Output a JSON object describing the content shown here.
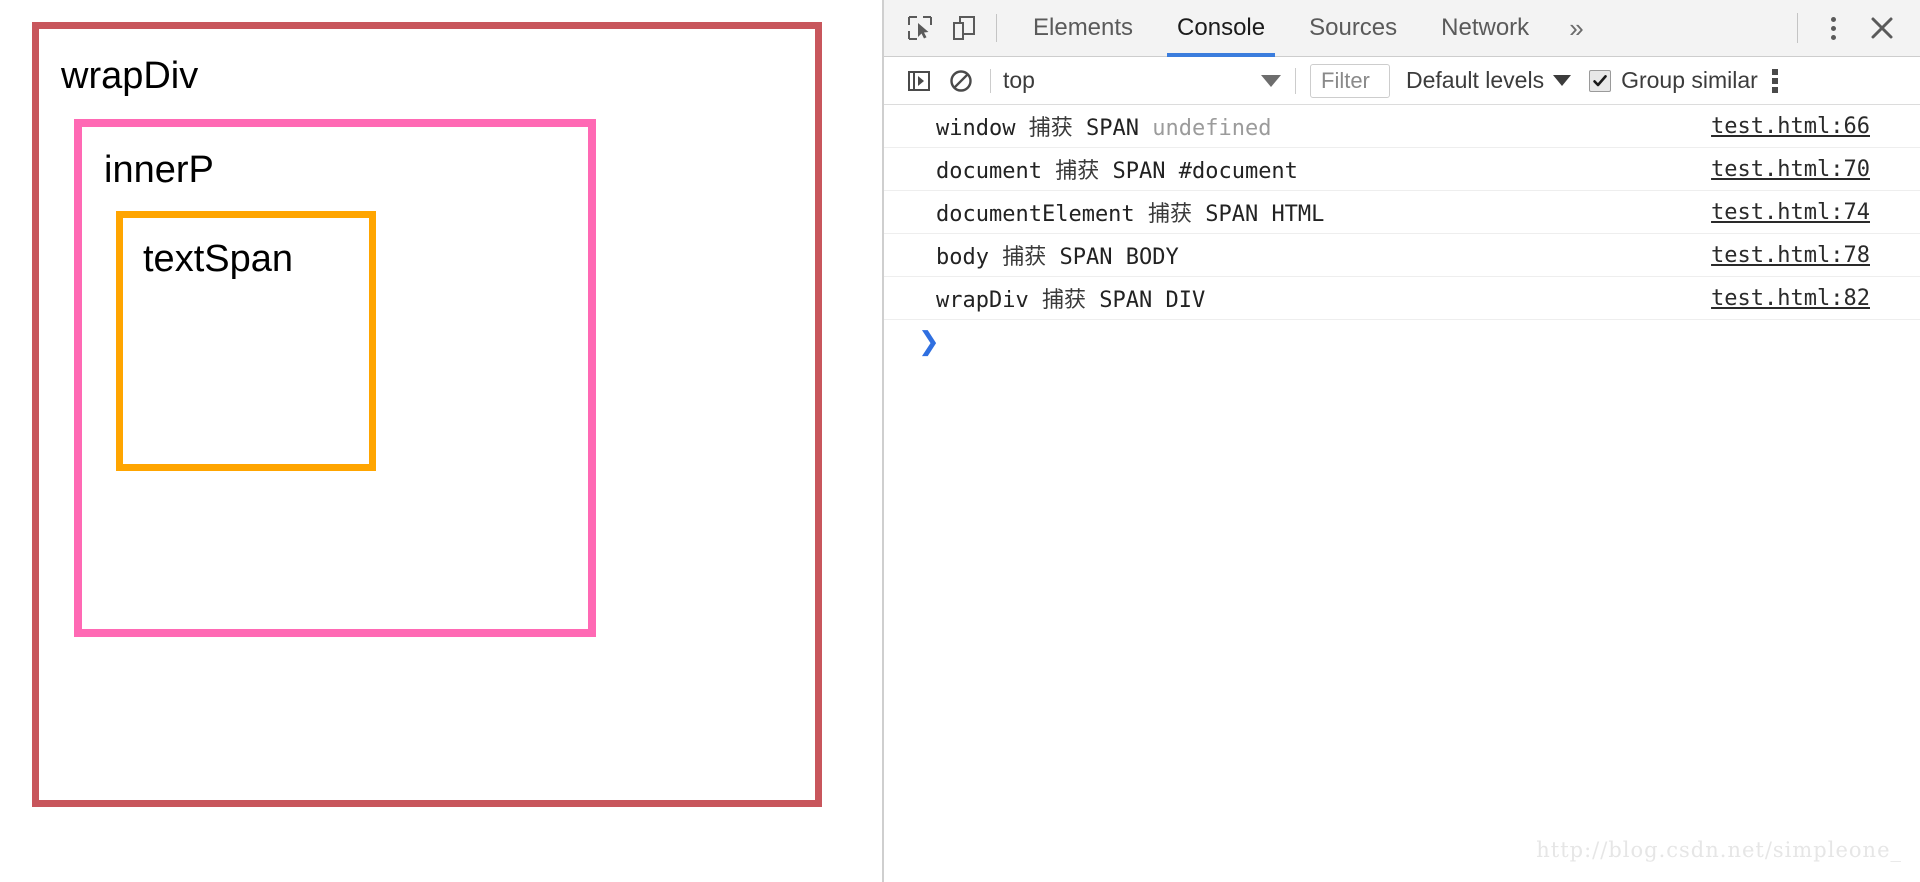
{
  "page": {
    "wrap_div_label": "wrapDiv",
    "inner_p_label": "innerP",
    "text_span_label": "textSpan",
    "colors": {
      "wrap_div_border": "#c8565c",
      "inner_p_border": "#ff69b4",
      "text_span_border": "#ffa500"
    }
  },
  "devtools": {
    "icons": {
      "inspect": "inspect-cursor-icon",
      "device": "device-toolbar-icon",
      "overflow": "chevron-double-right-icon",
      "kebab": "more-options-icon",
      "close": "close-icon",
      "execute": "execution-context-icon",
      "clear": "clear-console-icon"
    },
    "tabs": [
      {
        "label": "Elements",
        "active": false
      },
      {
        "label": "Console",
        "active": true
      },
      {
        "label": "Sources",
        "active": false
      },
      {
        "label": "Network",
        "active": false
      }
    ],
    "more_tabs_label": "»",
    "close_label": "✕",
    "toolbar": {
      "context_value": "top",
      "filter_placeholder": "Filter",
      "levels_label": "Default levels",
      "group_similar_label": "Group similar",
      "group_similar_checked": true
    },
    "messages": [
      {
        "name": "window",
        "action": "捕获",
        "tag": "SPAN",
        "value": "undefined",
        "value_dim": true,
        "source": "test.html:66"
      },
      {
        "name": "document",
        "action": "捕获",
        "tag": "SPAN",
        "value": "#document",
        "value_dim": false,
        "source": "test.html:70"
      },
      {
        "name": "documentElement",
        "action": "捕获",
        "tag": "SPAN",
        "value": "HTML",
        "value_dim": false,
        "source": "test.html:74"
      },
      {
        "name": "body",
        "action": "捕获",
        "tag": "SPAN",
        "value": "BODY",
        "value_dim": false,
        "source": "test.html:78"
      },
      {
        "name": "wrapDiv",
        "action": "捕获",
        "tag": "SPAN",
        "value": "DIV",
        "value_dim": false,
        "source": "test.html:82"
      }
    ],
    "prompt_caret": "❯",
    "accent_color": "#3b7ddd"
  },
  "watermark": "http://blog.csdn.net/simpleone_"
}
